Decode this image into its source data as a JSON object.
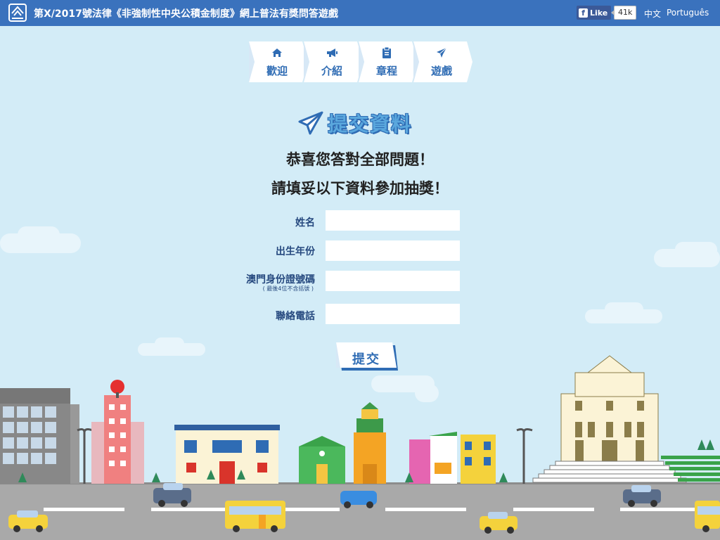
{
  "header": {
    "title": "第X/2017號法律《非強制性中央公積金制度》網上普法有獎問答遊戲",
    "facebook": {
      "like_label": "Like",
      "like_count": "41k"
    },
    "languages": [
      "中文",
      "Português"
    ]
  },
  "nav": {
    "tabs": [
      {
        "label": "歡迎",
        "icon": "home-icon"
      },
      {
        "label": "介紹",
        "icon": "megaphone-icon"
      },
      {
        "label": "章程",
        "icon": "clipboard-icon"
      },
      {
        "label": "遊戲",
        "icon": "paper-plane-icon"
      }
    ]
  },
  "form": {
    "title": "提交資料",
    "title_icon": "paper-plane-icon",
    "congrats": "恭喜您答對全部問題！",
    "instruction": "請填妥以下資料參加抽獎！",
    "fields": [
      {
        "label": "姓名",
        "value": "",
        "note": ""
      },
      {
        "label": "出生年份",
        "value": "",
        "note": ""
      },
      {
        "label": "澳門身份證號碼",
        "value": "",
        "note": "( 最後4位不含括號 )"
      },
      {
        "label": "聯絡電話",
        "value": "",
        "note": ""
      }
    ],
    "submit_label": "提交"
  },
  "colors": {
    "header_bg": "#3a72bd",
    "page_bg": "#d3ecf7",
    "accent": "#2f6cb4",
    "road": "#a9a9a9"
  }
}
